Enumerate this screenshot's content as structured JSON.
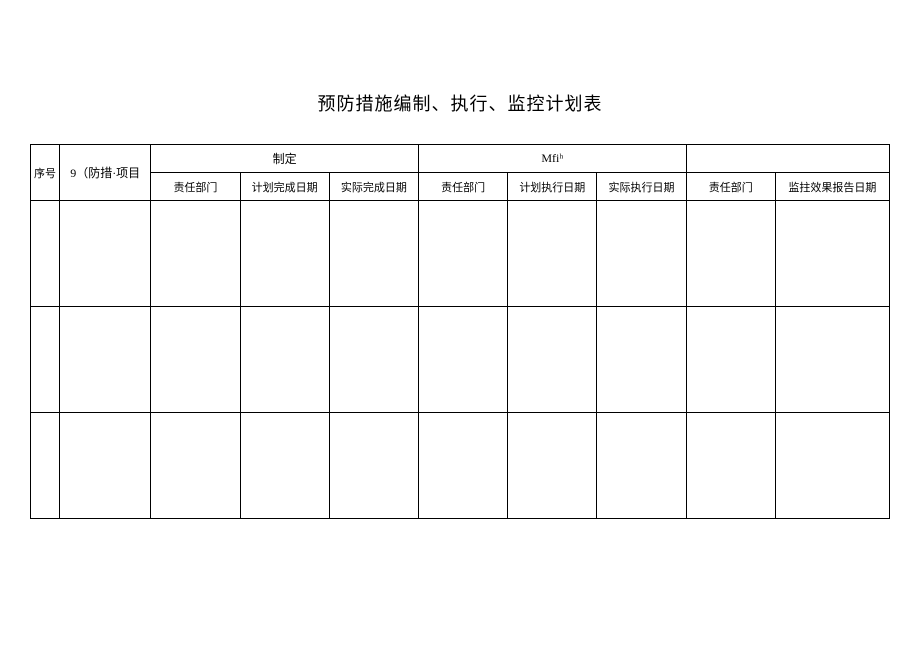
{
  "title": "预防措施编制、执行、监控计划表",
  "headers": {
    "seq": "序号",
    "project": "9（防措·项目",
    "group1": "制定",
    "group2": "Mfiʰ",
    "sub": {
      "dept1": "责任部门",
      "plan_complete_date": "计划完成日期",
      "actual_complete_date": "实际完成日期",
      "dept2": "责任部门",
      "plan_exec_date": "计划执行日期",
      "actual_exec_date": "实际执行日期",
      "dept3": "责任部门",
      "monitor_report_date": "监拄效果报告日期"
    }
  },
  "rows": [
    {
      "seq": "",
      "project": "",
      "dept1": "",
      "plan_complete_date": "",
      "actual_complete_date": "",
      "dept2": "",
      "plan_exec_date": "",
      "actual_exec_date": "",
      "dept3": "",
      "monitor_report_date": ""
    },
    {
      "seq": "",
      "project": "",
      "dept1": "",
      "plan_complete_date": "",
      "actual_complete_date": "",
      "dept2": "",
      "plan_exec_date": "",
      "actual_exec_date": "",
      "dept3": "",
      "monitor_report_date": ""
    },
    {
      "seq": "",
      "project": "",
      "dept1": "",
      "plan_complete_date": "",
      "actual_complete_date": "",
      "dept2": "",
      "plan_exec_date": "",
      "actual_exec_date": "",
      "dept3": "",
      "monitor_report_date": ""
    }
  ]
}
